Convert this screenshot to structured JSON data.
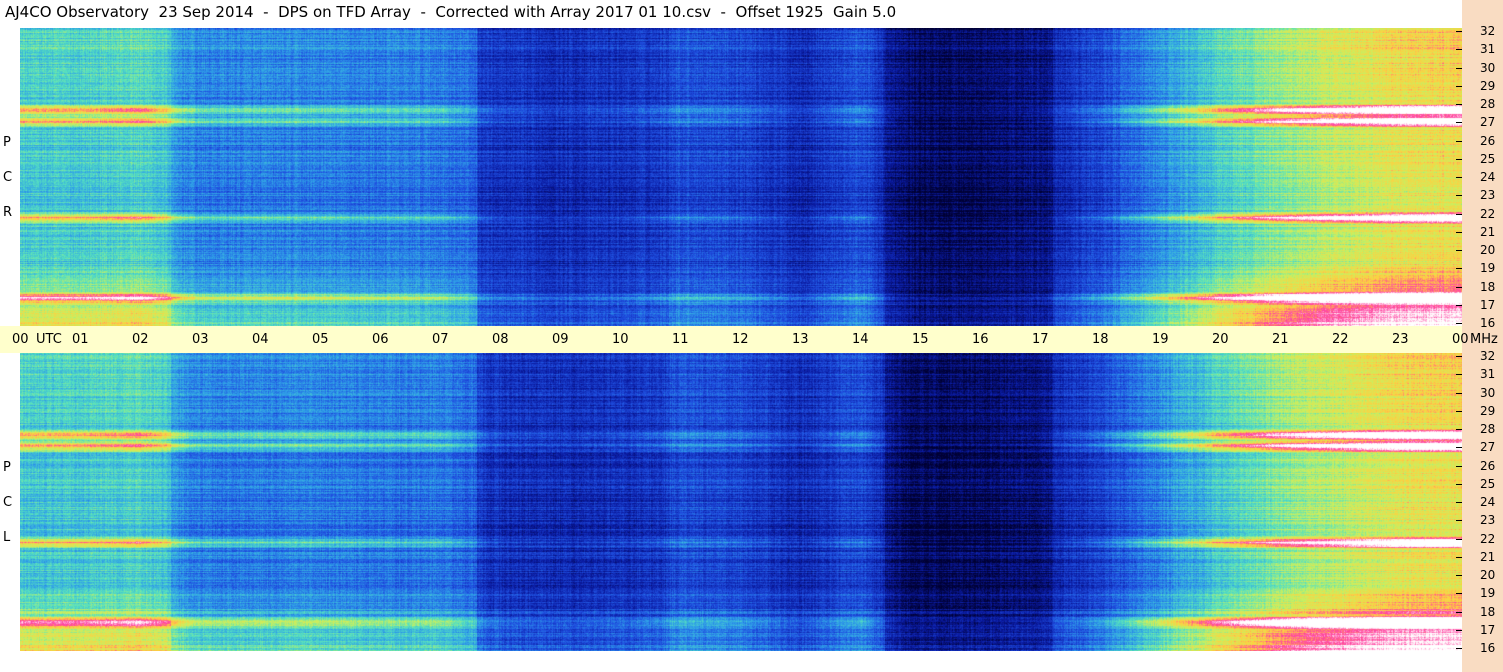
{
  "title": "AJ4CO Observatory  23 Sep 2014  -  DPS on TFD Array  -  Corrected with Array 2017 01 10.csv  -  Offset 1925  Gain 5.0",
  "chart_data": {
    "type": "heatmap",
    "panels": [
      {
        "name": "RCP",
        "label_letters": [
          "P",
          "C",
          "R"
        ]
      },
      {
        "name": "LCP",
        "label_letters": [
          "P",
          "C",
          "L"
        ]
      }
    ],
    "x_axis": {
      "unit_label": "UTC",
      "range_hours": [
        0,
        24
      ],
      "tick_labels": [
        "00",
        "01",
        "02",
        "03",
        "04",
        "05",
        "06",
        "07",
        "08",
        "09",
        "10",
        "11",
        "12",
        "13",
        "14",
        "15",
        "16",
        "17",
        "18",
        "19",
        "20",
        "21",
        "22",
        "23",
        "00"
      ]
    },
    "y_axis": {
      "unit_label": "MHz",
      "range_mhz": [
        16,
        32
      ],
      "tick_labels": [
        "32",
        "31",
        "30",
        "29",
        "28",
        "27",
        "26",
        "25",
        "24",
        "23",
        "22",
        "21",
        "20",
        "19",
        "18",
        "17",
        "16"
      ]
    },
    "colormap": [
      "#000033",
      "#0a1aa0",
      "#1f4fe0",
      "#2f9fe8",
      "#55e0c0",
      "#c8f060",
      "#ffd040",
      "#ff3fa0",
      "#ffffff"
    ],
    "intensity_profile_by_hour": [
      0.45,
      0.45,
      0.5,
      0.32,
      0.32,
      0.32,
      0.3,
      0.3,
      0.18,
      0.16,
      0.18,
      0.24,
      0.22,
      0.16,
      0.24,
      0.05,
      0.06,
      0.14,
      0.22,
      0.34,
      0.46,
      0.56,
      0.62,
      0.68,
      0.7
    ],
    "bright_bands_mhz": [
      27.0,
      17.5,
      21.8,
      27.6
    ],
    "blocks": [
      {
        "start_hour": 0.0,
        "end_hour": 2.5,
        "level": 0.45
      },
      {
        "start_hour": 2.5,
        "end_hour": 7.6,
        "level": 0.32
      },
      {
        "start_hour": 7.6,
        "end_hour": 10.8,
        "level": 0.17
      },
      {
        "start_hour": 14.4,
        "end_hour": 17.2,
        "level": 0.04
      }
    ]
  }
}
